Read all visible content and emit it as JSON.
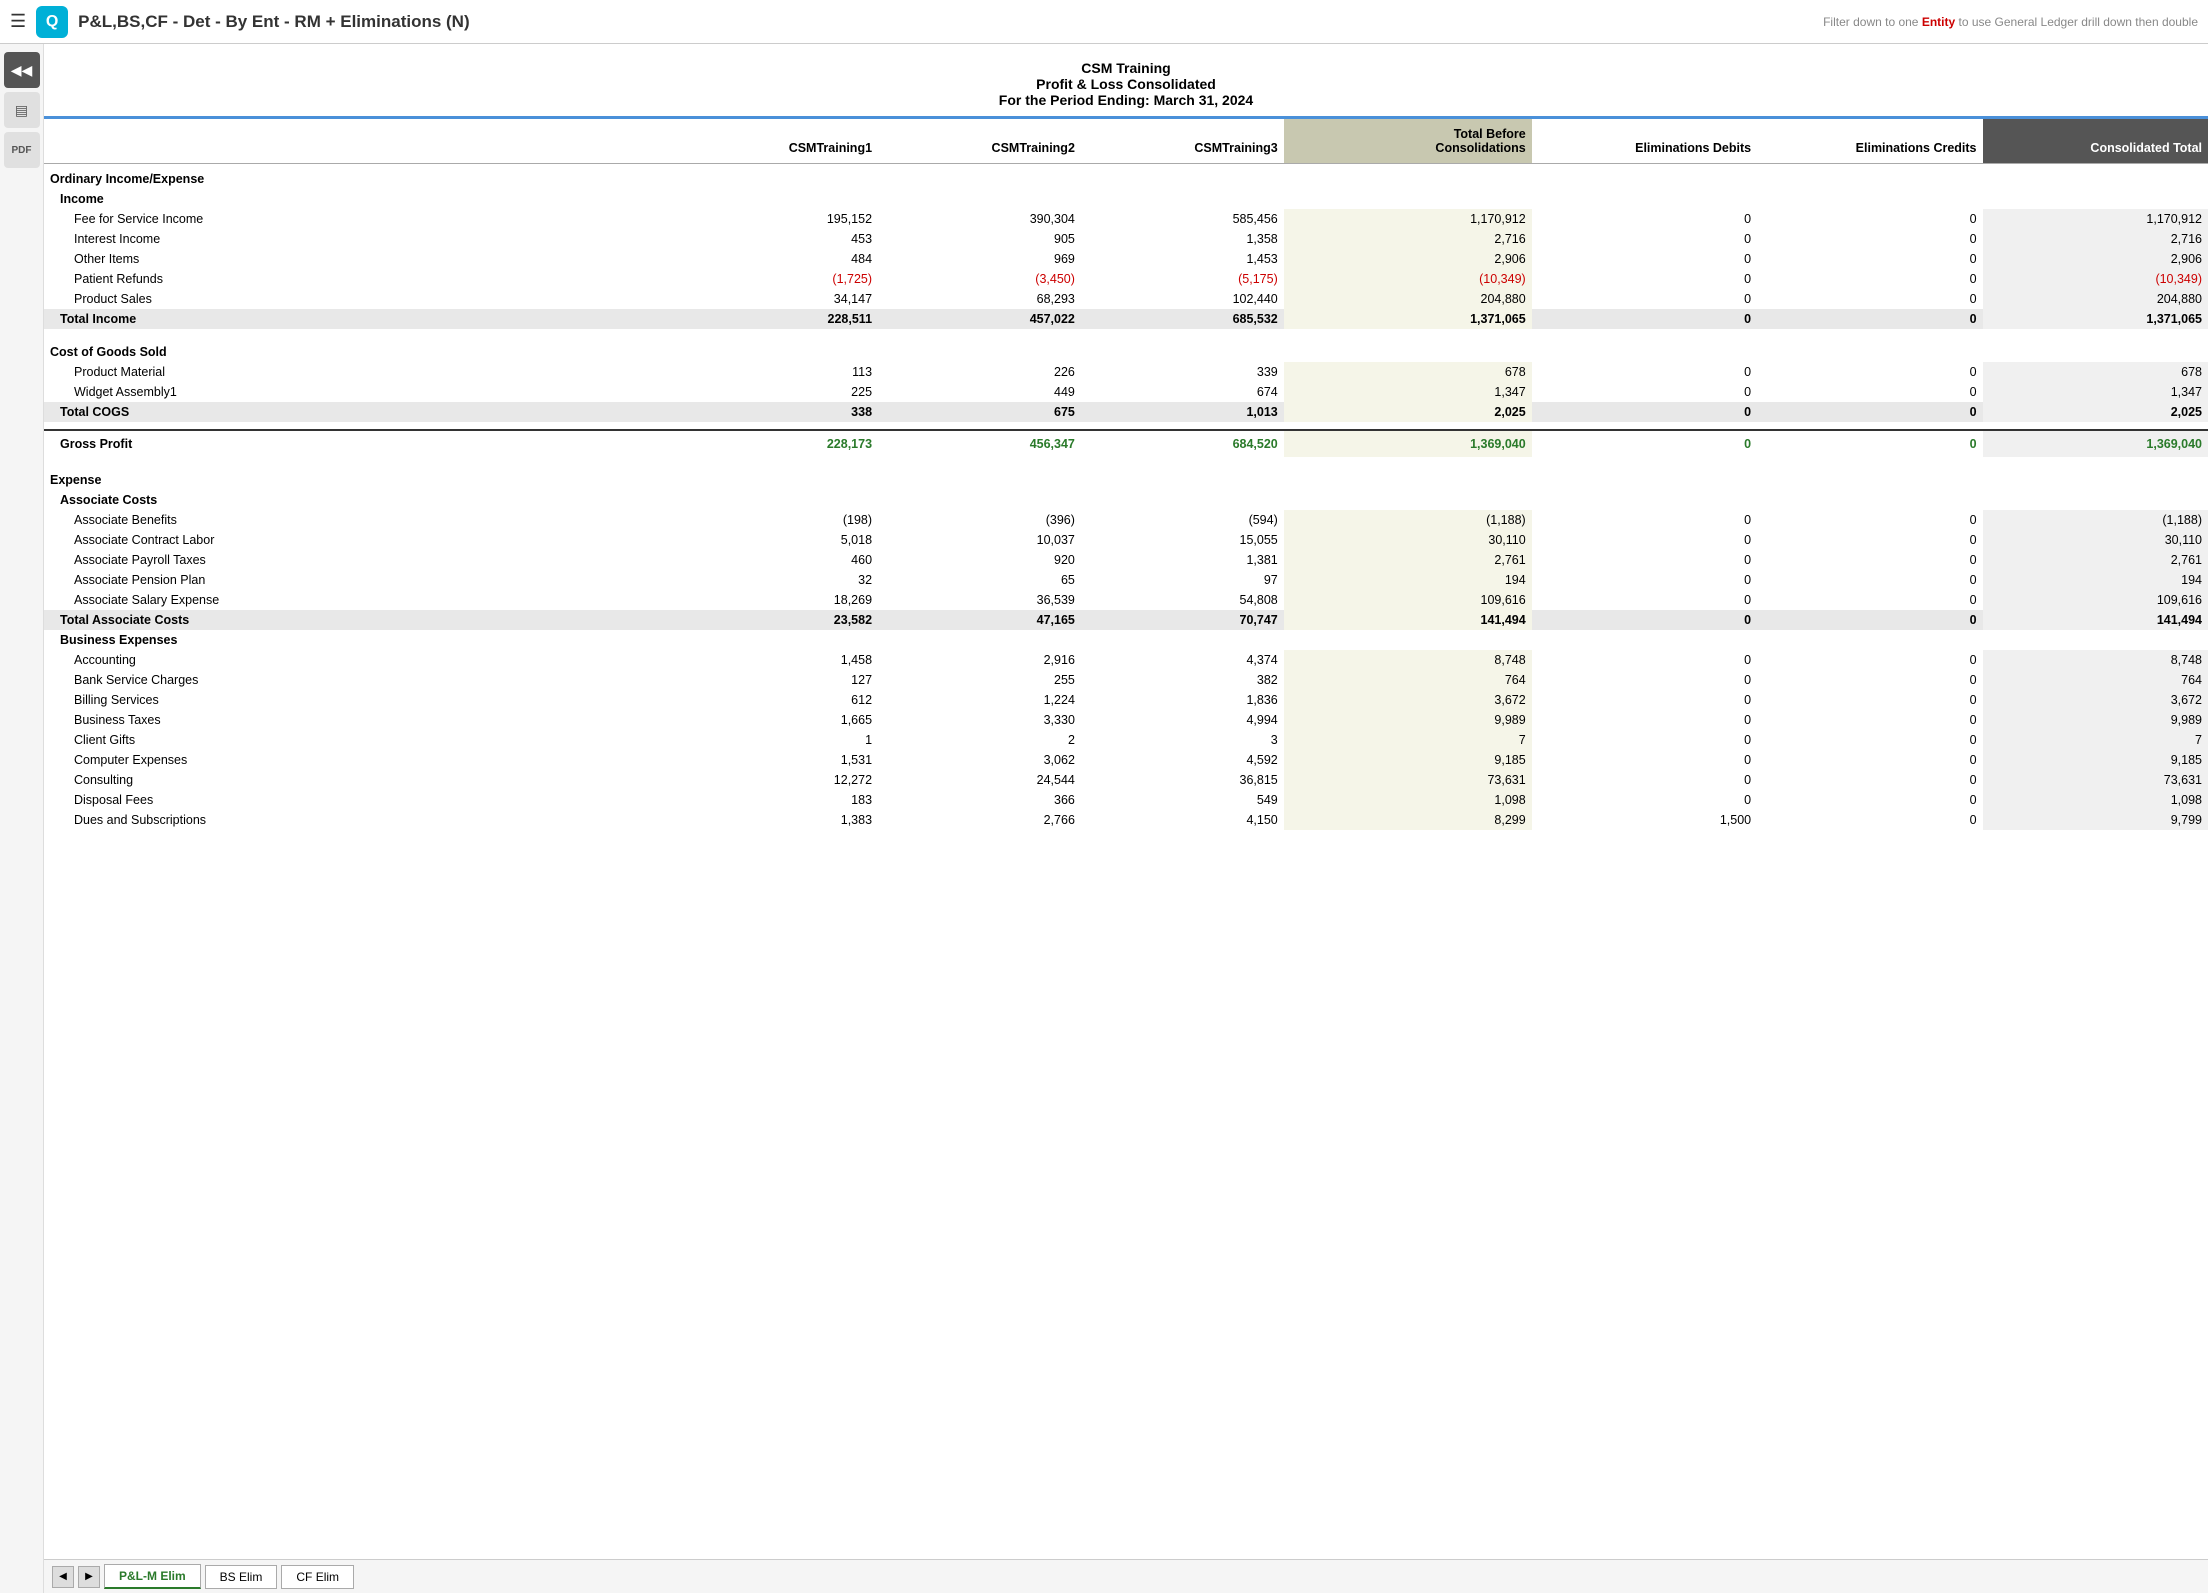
{
  "app": {
    "hamburger": "☰",
    "logo_letter": "Q",
    "title": "P&L,BS,CF - Det - By Ent - RM + Eliminations (N)",
    "filter_hint": "Filter down to one ",
    "filter_entity": "Entity",
    "filter_hint2": " to use General Ledger drill down then double"
  },
  "report": {
    "company": "CSM Training",
    "title": "Profit & Loss Consolidated",
    "period": "For the Period Ending: March 31, 2024"
  },
  "columns": {
    "label": "",
    "col1": "CSMTraining1",
    "col2": "CSMTraining2",
    "col3": "CSMTraining3",
    "col4": "Total Before\nConsolidations",
    "col5": "Eliminations Debits",
    "col6": "Eliminations Credits",
    "col7": "Consolidated Total"
  },
  "rows": [
    {
      "type": "section",
      "label": "Ordinary Income/Expense",
      "indent": 0
    },
    {
      "type": "subsection",
      "label": "Income",
      "indent": 1
    },
    {
      "type": "detail",
      "label": "Fee for Service Income",
      "v1": "195,152",
      "v2": "390,304",
      "v3": "585,456",
      "v4": "1,170,912",
      "v5": "0",
      "v6": "0",
      "v7": "1,170,912"
    },
    {
      "type": "detail",
      "label": "Interest Income",
      "v1": "453",
      "v2": "905",
      "v3": "1,358",
      "v4": "2,716",
      "v5": "0",
      "v6": "0",
      "v7": "2,716"
    },
    {
      "type": "detail",
      "label": "Other Items",
      "v1": "484",
      "v2": "969",
      "v3": "1,453",
      "v4": "2,906",
      "v5": "0",
      "v6": "0",
      "v7": "2,906"
    },
    {
      "type": "detail",
      "label": "Patient Refunds",
      "v1": "(1,725)",
      "v2": "(3,450)",
      "v3": "(5,175)",
      "v4": "(10,349)",
      "v5": "0",
      "v6": "0",
      "v7": "(10,349)",
      "red": true
    },
    {
      "type": "detail",
      "label": "Product Sales",
      "v1": "34,147",
      "v2": "68,293",
      "v3": "102,440",
      "v4": "204,880",
      "v5": "0",
      "v6": "0",
      "v7": "204,880"
    },
    {
      "type": "total",
      "label": "Total Income",
      "v1": "228,511",
      "v2": "457,022",
      "v3": "685,532",
      "v4": "1,371,065",
      "v5": "0",
      "v6": "0",
      "v7": "1,371,065"
    },
    {
      "type": "spacer"
    },
    {
      "type": "section",
      "label": "Cost of Goods Sold",
      "indent": 0
    },
    {
      "type": "detail",
      "label": "Product Material",
      "v1": "113",
      "v2": "226",
      "v3": "339",
      "v4": "678",
      "v5": "0",
      "v6": "0",
      "v7": "678"
    },
    {
      "type": "detail",
      "label": "Widget Assembly1",
      "v1": "225",
      "v2": "449",
      "v3": "674",
      "v4": "1,347",
      "v5": "0",
      "v6": "0",
      "v7": "1,347"
    },
    {
      "type": "total",
      "label": "Total COGS",
      "v1": "338",
      "v2": "675",
      "v3": "1,013",
      "v4": "2,025",
      "v5": "0",
      "v6": "0",
      "v7": "2,025"
    },
    {
      "type": "spacer"
    },
    {
      "type": "gross_profit",
      "label": "Gross Profit",
      "v1": "228,173",
      "v2": "456,347",
      "v3": "684,520",
      "v4": "1,369,040",
      "v5": "0",
      "v6": "0",
      "v7": "1,369,040",
      "green": true
    },
    {
      "type": "spacer"
    },
    {
      "type": "section",
      "label": "Expense",
      "indent": 0
    },
    {
      "type": "subsection",
      "label": "Associate Costs",
      "indent": 1
    },
    {
      "type": "detail",
      "label": "Associate Benefits",
      "v1": "(198)",
      "v2": "(396)",
      "v3": "(594)",
      "v4": "(1,188)",
      "v5": "0",
      "v6": "0",
      "v7": "(1,188)"
    },
    {
      "type": "detail",
      "label": "Associate Contract Labor",
      "v1": "5,018",
      "v2": "10,037",
      "v3": "15,055",
      "v4": "30,110",
      "v5": "0",
      "v6": "0",
      "v7": "30,110"
    },
    {
      "type": "detail",
      "label": "Associate Payroll Taxes",
      "v1": "460",
      "v2": "920",
      "v3": "1,381",
      "v4": "2,761",
      "v5": "0",
      "v6": "0",
      "v7": "2,761"
    },
    {
      "type": "detail",
      "label": "Associate Pension Plan",
      "v1": "32",
      "v2": "65",
      "v3": "97",
      "v4": "194",
      "v5": "0",
      "v6": "0",
      "v7": "194"
    },
    {
      "type": "detail",
      "label": "Associate Salary Expense",
      "v1": "18,269",
      "v2": "36,539",
      "v3": "54,808",
      "v4": "109,616",
      "v5": "0",
      "v6": "0",
      "v7": "109,616"
    },
    {
      "type": "total",
      "label": "Total Associate Costs",
      "v1": "23,582",
      "v2": "47,165",
      "v3": "70,747",
      "v4": "141,494",
      "v5": "0",
      "v6": "0",
      "v7": "141,494"
    },
    {
      "type": "subsection",
      "label": "Business Expenses",
      "indent": 1
    },
    {
      "type": "detail",
      "label": "Accounting",
      "v1": "1,458",
      "v2": "2,916",
      "v3": "4,374",
      "v4": "8,748",
      "v5": "0",
      "v6": "0",
      "v7": "8,748"
    },
    {
      "type": "detail",
      "label": "Bank Service Charges",
      "v1": "127",
      "v2": "255",
      "v3": "382",
      "v4": "764",
      "v5": "0",
      "v6": "0",
      "v7": "764"
    },
    {
      "type": "detail",
      "label": "Billing Services",
      "v1": "612",
      "v2": "1,224",
      "v3": "1,836",
      "v4": "3,672",
      "v5": "0",
      "v6": "0",
      "v7": "3,672"
    },
    {
      "type": "detail",
      "label": "Business Taxes",
      "v1": "1,665",
      "v2": "3,330",
      "v3": "4,994",
      "v4": "9,989",
      "v5": "0",
      "v6": "0",
      "v7": "9,989"
    },
    {
      "type": "detail",
      "label": "Client Gifts",
      "v1": "1",
      "v2": "2",
      "v3": "3",
      "v4": "7",
      "v5": "0",
      "v6": "0",
      "v7": "7"
    },
    {
      "type": "detail",
      "label": "Computer Expenses",
      "v1": "1,531",
      "v2": "3,062",
      "v3": "4,592",
      "v4": "9,185",
      "v5": "0",
      "v6": "0",
      "v7": "9,185"
    },
    {
      "type": "detail",
      "label": "Consulting",
      "v1": "12,272",
      "v2": "24,544",
      "v3": "36,815",
      "v4": "73,631",
      "v5": "0",
      "v6": "0",
      "v7": "73,631"
    },
    {
      "type": "detail",
      "label": "Disposal Fees",
      "v1": "183",
      "v2": "366",
      "v3": "549",
      "v4": "1,098",
      "v5": "0",
      "v6": "0",
      "v7": "1,098"
    },
    {
      "type": "detail",
      "label": "Dues and Subscriptions",
      "v1": "1,383",
      "v2": "2,766",
      "v3": "4,150",
      "v4": "8,299",
      "v5": "1,500",
      "v6": "0",
      "v7": "9,799"
    }
  ],
  "tabs": [
    "P&L-M Elim",
    "BS Elim",
    "CF Elim"
  ],
  "active_tab": "P&L-M Elim",
  "sidebar_buttons": [
    {
      "icon": "◀◀",
      "name": "rewind",
      "active": true
    },
    {
      "icon": "≡",
      "name": "menu",
      "active": false
    },
    {
      "icon": "PDF",
      "name": "pdf",
      "active": false
    }
  ]
}
